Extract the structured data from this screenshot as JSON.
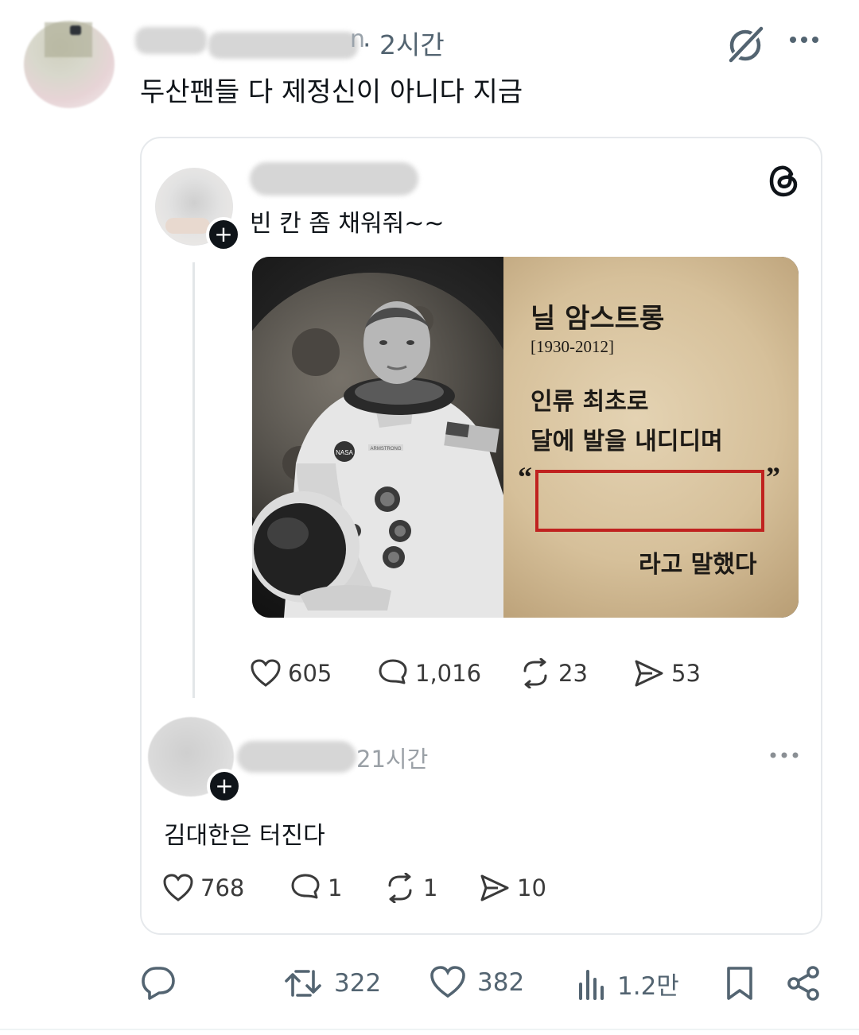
{
  "tweet": {
    "author_suffix": "n",
    "time": "· 2시간",
    "text": "두산팬들 다 제정신이 아니다 지금"
  },
  "embedded": {
    "app": "threads",
    "post": {
      "text": "빈 칸 좀 채워줘~~",
      "image": {
        "title": "닐 암스트롱",
        "years": "[1930-2012]",
        "line1": "인류 최초로",
        "line2": "달에 발을 내디디며",
        "quote_open": "“",
        "quote_close": "”",
        "ending": "라고 말했다",
        "patch_text": "NASA",
        "name_tag": "ARMSTRONG"
      },
      "stats": {
        "likes": "605",
        "replies": "1,016",
        "reposts": "23",
        "shares": "53"
      }
    },
    "reply": {
      "time": "21시간",
      "text": "김대한은 터진다",
      "stats": {
        "likes": "768",
        "replies": "1",
        "reposts": "1",
        "shares": "10"
      }
    }
  },
  "action_bar": {
    "retweets": "322",
    "likes": "382",
    "views": "1.2만"
  },
  "colors": {
    "muted": "#536471",
    "text": "#0f1419",
    "red_box": "#c0221f"
  }
}
